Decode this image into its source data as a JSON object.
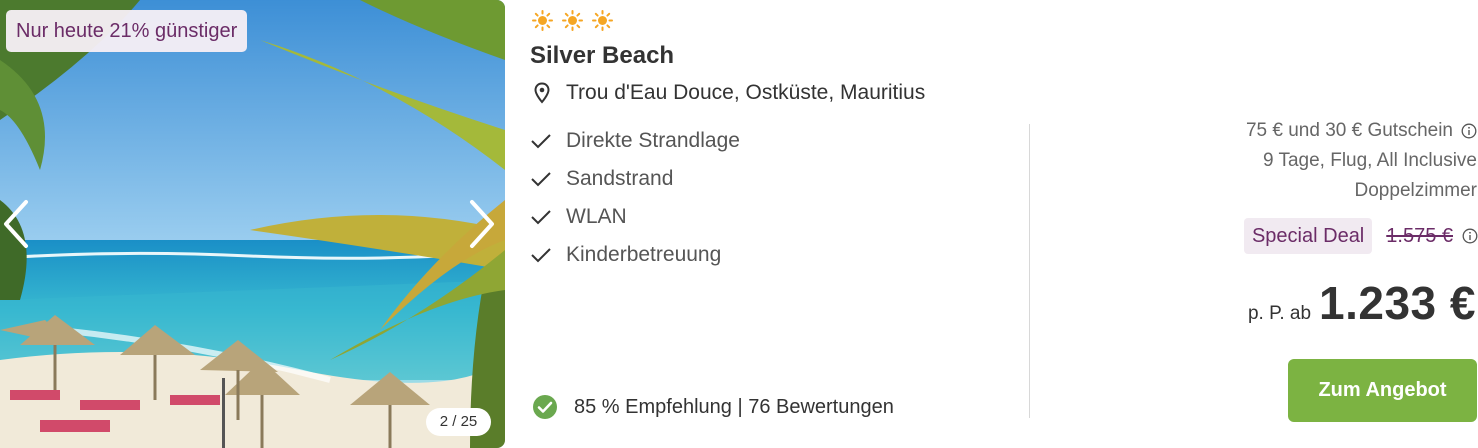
{
  "gallery": {
    "discount_badge": "Nur heute 21% günstiger",
    "counter": "2 / 25"
  },
  "hotel": {
    "stars": 3,
    "name": "Silver Beach",
    "location": "Trou d'Eau Douce, Ostküste, Mauritius"
  },
  "features": [
    "Direkte Strandlage",
    "Sandstrand",
    "WLAN",
    "Kinderbetreuung"
  ],
  "rating": {
    "text": "85 % Empfehlung | 76 Bewertungen"
  },
  "offer": {
    "voucher": "75 € und 30 € Gutschein",
    "package": "9 Tage, Flug, All Inclusive",
    "room": "Doppelzimmer",
    "deal_badge": "Special Deal",
    "old_price": "1.575 €",
    "price_prefix": "p. P. ab",
    "price": "1.233 €",
    "cta_label": "Zum Angebot"
  },
  "colors": {
    "accent_purple": "#6b2c67",
    "cta_green": "#7cb342",
    "star_orange": "#f5a623",
    "check_green": "#6aa84f"
  },
  "icons": {
    "star": "sun-icon",
    "location": "map-pin-icon",
    "feature": "check-icon",
    "rating": "check-circle-icon",
    "info": "info-icon",
    "prev": "chevron-left-icon",
    "next": "chevron-right-icon"
  }
}
